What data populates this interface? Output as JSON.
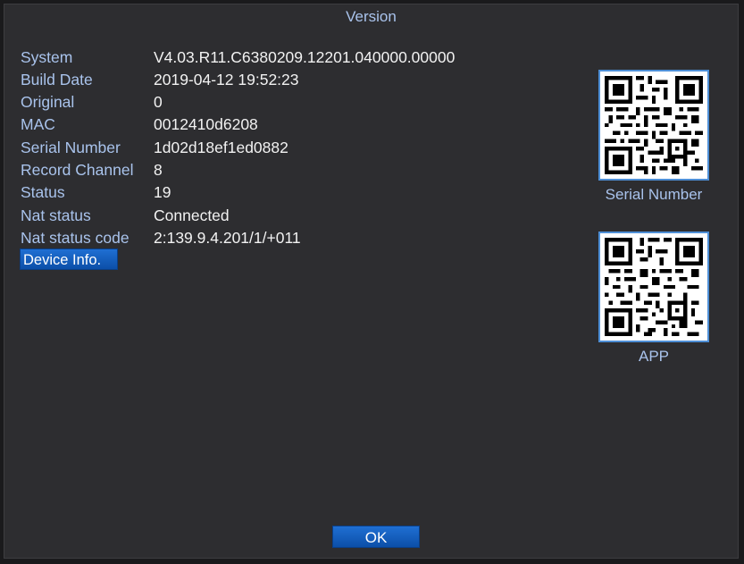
{
  "dialog": {
    "title": "Version"
  },
  "info": [
    {
      "label": "System",
      "value": "V4.03.R11.C6380209.12201.040000.00000"
    },
    {
      "label": "Build Date",
      "value": "2019-04-12 19:52:23"
    },
    {
      "label": "Original",
      "value": "0"
    },
    {
      "label": "MAC",
      "value": "0012410d6208"
    },
    {
      "label": "Serial Number",
      "value": "1d02d18ef1ed0882"
    },
    {
      "label": "Record Channel",
      "value": "8"
    },
    {
      "label": "Status",
      "value": "19"
    },
    {
      "label": "Nat status",
      "value": "Connected"
    },
    {
      "label": "Nat status code",
      "value": "2:139.9.4.201/1/+011"
    }
  ],
  "buttons": {
    "device_info": "Device Info.",
    "ok": "OK"
  },
  "qr": {
    "serial_caption": "Serial Number",
    "app_caption": "APP"
  },
  "colors": {
    "background": "#2d2d30",
    "label_text": "#a9c3ec",
    "value_text": "#f2f2f2",
    "button_blue": "#1463c2",
    "qr_border": "#4e8fd6"
  }
}
